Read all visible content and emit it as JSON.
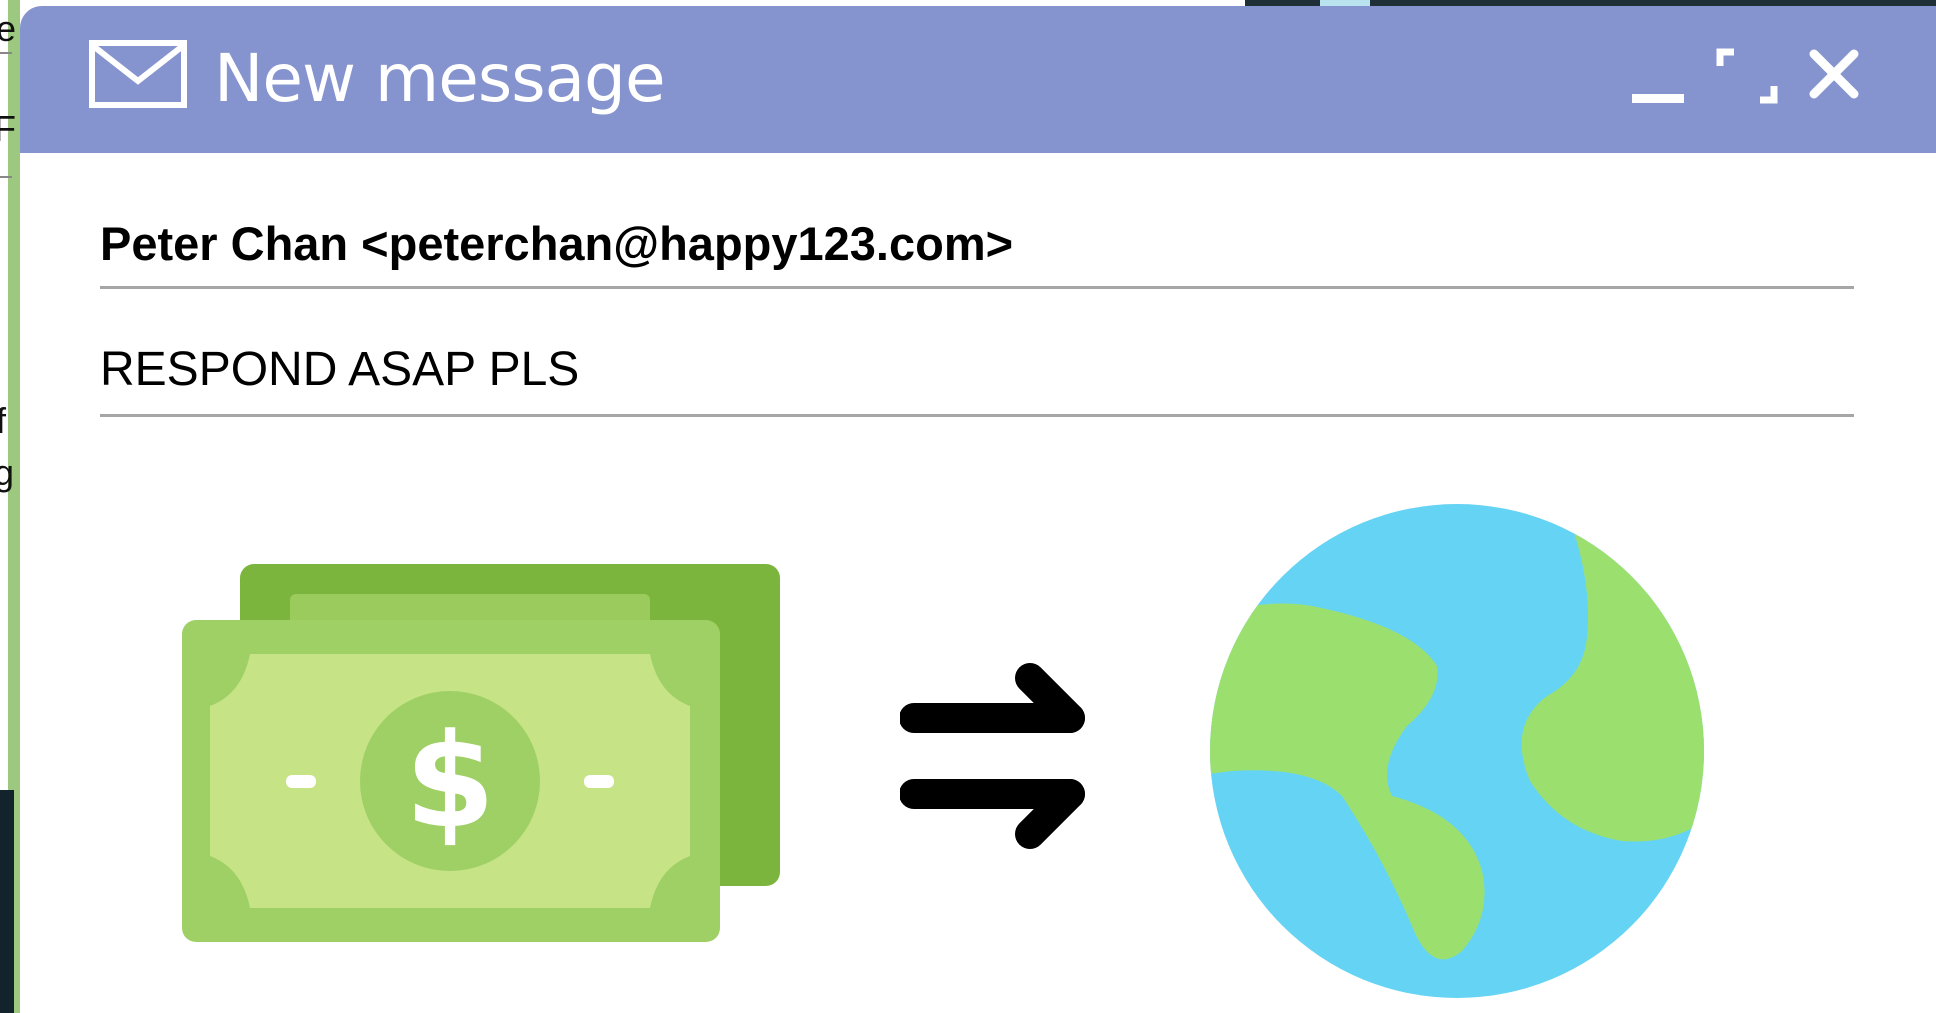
{
  "window": {
    "title": "New message",
    "colors": {
      "titlebar": "#8593ce",
      "money_green": "#9fd065",
      "globe_blue": "#65d3f3",
      "land_green": "#9be06f"
    }
  },
  "to": {
    "value": "Peter Chan <peterchan@happy123.com>"
  },
  "subject": {
    "value": "RESPOND ASAP PLS"
  },
  "icons": {
    "mail": "mail-icon",
    "minimize": "minimize-icon",
    "maximize": "maximize-icon",
    "close": "close-icon",
    "money": "money-illustration",
    "exchange": "exchange-arrows-icon",
    "globe": "globe-illustration"
  },
  "money": {
    "symbol": "$"
  },
  "background": {
    "fragments": [
      "e",
      "F",
      "f",
      "g"
    ]
  }
}
